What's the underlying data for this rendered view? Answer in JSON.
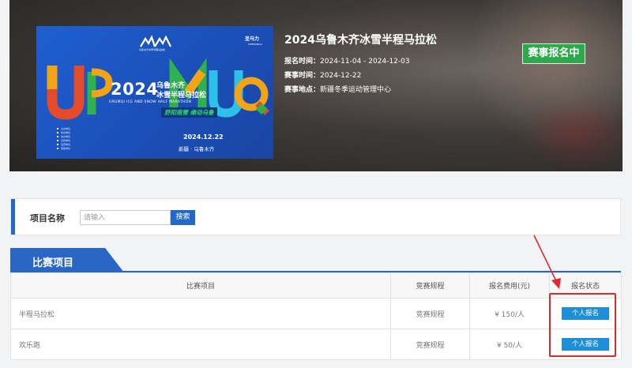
{
  "event": {
    "title": "2024乌鲁木齐冰雪半程马拉松",
    "status": "赛事报名中",
    "info": [
      {
        "label": "报名时间：",
        "value": "2024-11-04 - 2024-12-03"
      },
      {
        "label": "赛事时间：",
        "value": "2024-12-22"
      },
      {
        "label": "赛事地点：",
        "value": "新疆冬季运动管理中心"
      }
    ]
  },
  "poster": {
    "year": "2024",
    "title_line1": "乌鲁木齐",
    "title_line2": "冰雪半程马拉松",
    "english": "URUMQI ICE AND SNOW HALF MARATHON",
    "slogan": "舒阳南雪 缘动乌鲁",
    "date": "2024.12.22",
    "place": "新疆 · 乌鲁木齐",
    "brand": "圣马力",
    "brand_sub": "SHENGMALI",
    "logo_text": "乌鲁木齐冰雪半程马拉松",
    "org_lines": [
      "主办单位",
      "承办单位",
      "协办单位",
      "支持单位",
      "运营单位",
      "赞助单位"
    ],
    "big_letters": [
      "U",
      "R",
      "U",
      "M",
      "Q"
    ]
  },
  "search": {
    "label": "项目名称",
    "placeholder": "请输入",
    "button": "搜索"
  },
  "section": {
    "title": "比赛项目"
  },
  "table": {
    "headers": [
      "比赛项目",
      "竞赛规程",
      "报名费用(元)",
      "报名状态"
    ],
    "rows": [
      {
        "name": "半程马拉松",
        "rules": "竞赛规程",
        "fee": "¥ 150/人",
        "action": "个人报名"
      },
      {
        "name": "欢乐跑",
        "rules": "竞赛规程",
        "fee": "¥ 50/人",
        "action": "个人报名"
      }
    ]
  },
  "colors": {
    "primary": "#2567c9",
    "status_green": "#2ea84c",
    "action_blue": "#1d8fd8",
    "annotation_red": "#e02a2a"
  }
}
